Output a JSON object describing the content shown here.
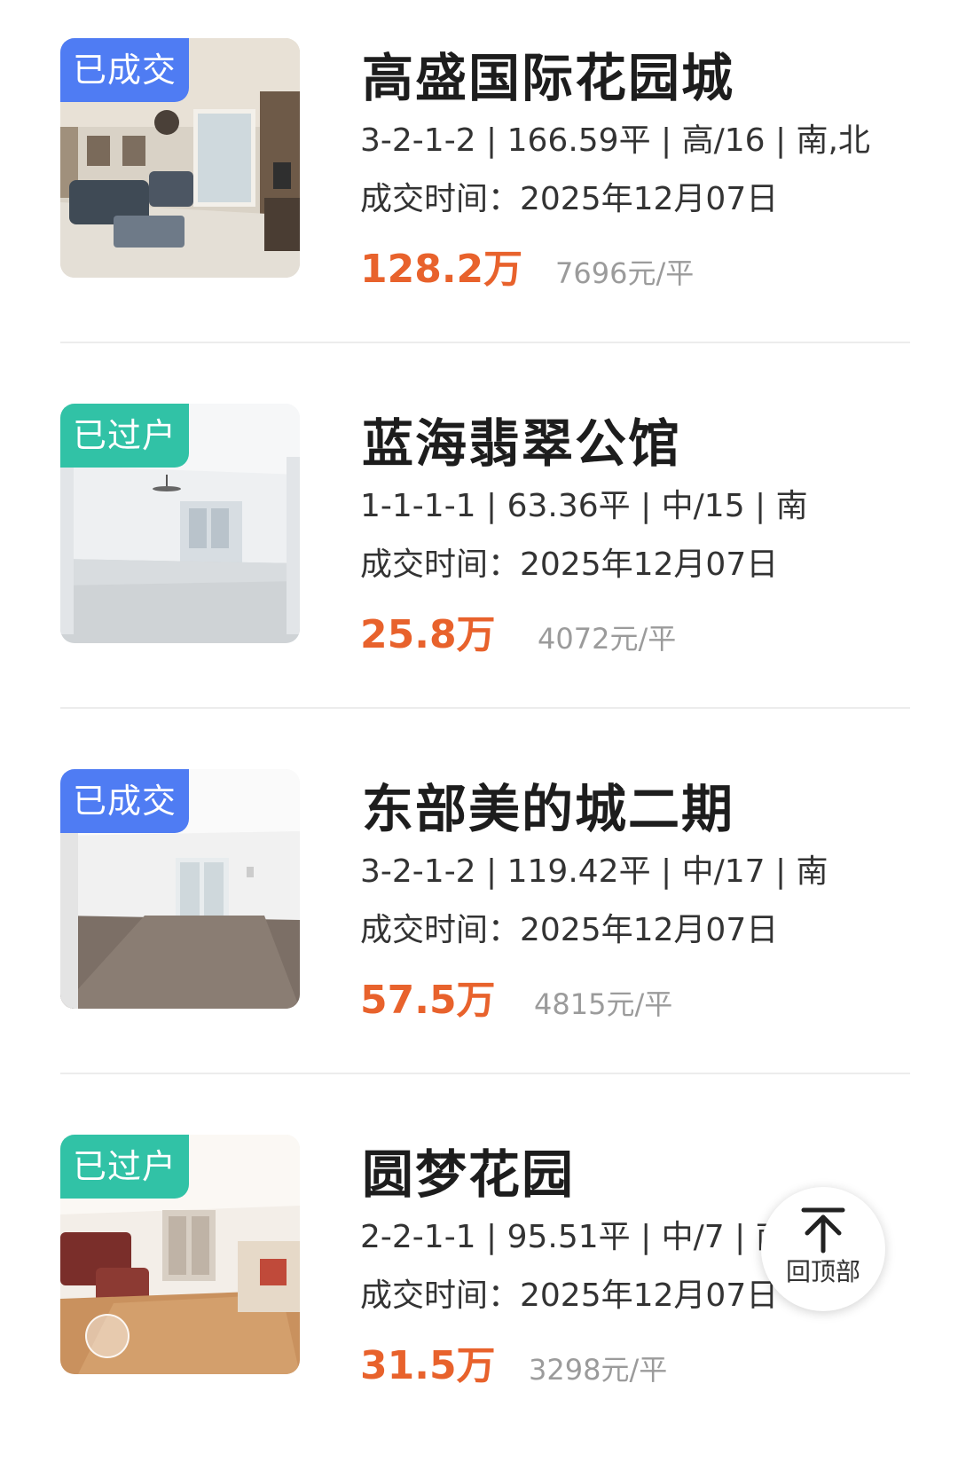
{
  "listings": [
    {
      "badge": "已成交",
      "title": "高盛国际花园城",
      "specs": "3-2-1-2 | 166.59平 | 高/16 | 南,北",
      "deal_time": "成交时间：2025年12月07日",
      "price": "128.2万",
      "unit_price": "7696元/平",
      "badge_color": "#4f7cf3"
    },
    {
      "badge": "已过户",
      "title": "蓝海翡翠公馆",
      "specs": "1-1-1-1 | 63.36平 | 中/15 | 南",
      "deal_time": "成交时间：2025年12月07日",
      "price": "25.8万",
      "unit_price": "4072元/平",
      "badge_color": "#31c2a6"
    },
    {
      "badge": "已成交",
      "title": "东部美的城二期",
      "specs": "3-2-1-2 | 119.42平 | 中/17 | 南",
      "deal_time": "成交时间：2025年12月07日",
      "price": "57.5万",
      "unit_price": "4815元/平",
      "badge_color": "#4f7cf3"
    },
    {
      "badge": "已过户",
      "title": "圆梦花园",
      "specs": "2-2-1-1 | 95.51平 | 中/7 | 南",
      "deal_time": "成交时间：2025年12月07日",
      "price": "31.5万",
      "unit_price": "3298元/平",
      "badge_color": "#31c2a6"
    }
  ],
  "back_to_top": {
    "label": "回顶部",
    "icon": "arrow-up-icon"
  },
  "colors": {
    "price": "#e8622c",
    "unit_price": "#9b9b9b",
    "divider": "#ececec"
  }
}
